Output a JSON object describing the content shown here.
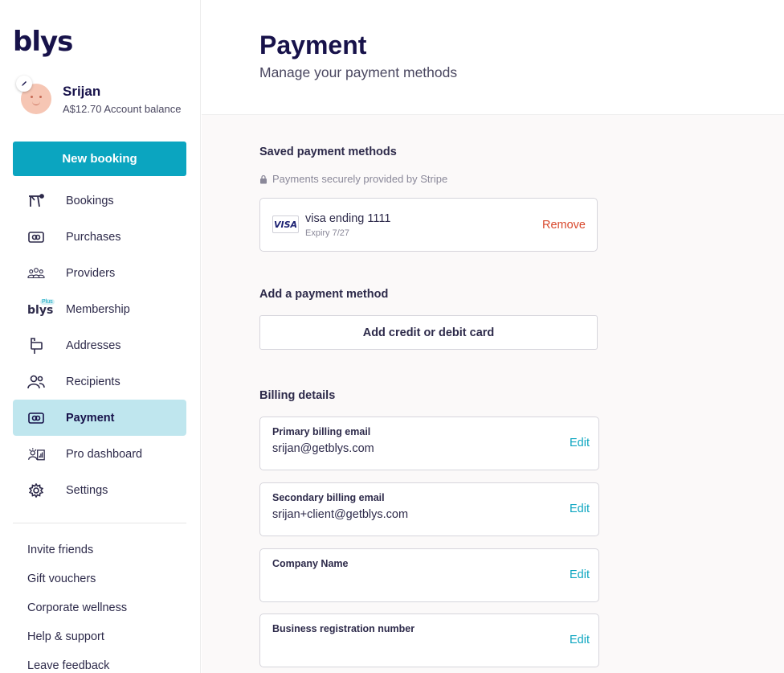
{
  "sidebar": {
    "logo": "blys",
    "user": {
      "name": "Srijan",
      "balance": "A$12.70 Account balance"
    },
    "new_booking_label": "New booking",
    "nav": [
      {
        "label": "Bookings",
        "icon": "massage-table-icon"
      },
      {
        "label": "Purchases",
        "icon": "money-icon"
      },
      {
        "label": "Providers",
        "icon": "providers-group-icon"
      },
      {
        "label": "Membership",
        "icon": "blys-plus-icon",
        "badge": "Plus",
        "icon_text": "blys"
      },
      {
        "label": "Addresses",
        "icon": "mailbox-icon"
      },
      {
        "label": "Recipients",
        "icon": "people-icon"
      },
      {
        "label": "Payment",
        "icon": "money-icon",
        "active": true
      },
      {
        "label": "Pro dashboard",
        "icon": "pro-dashboard-icon"
      },
      {
        "label": "Settings",
        "icon": "gear-icon"
      }
    ],
    "links": [
      "Invite friends",
      "Gift vouchers",
      "Corporate wellness",
      "Help & support",
      "Leave feedback"
    ]
  },
  "header": {
    "title": "Payment",
    "subtitle": "Manage your payment methods"
  },
  "saved_methods": {
    "title": "Saved payment methods",
    "stripe_note": "Payments securely provided by Stripe",
    "card": {
      "brand": "VISA",
      "number": "visa ending 1111",
      "expiry": "Expiry 7/27",
      "remove_label": "Remove"
    }
  },
  "add_method": {
    "title": "Add a payment method",
    "button_label": "Add credit or debit card"
  },
  "billing": {
    "title": "Billing details",
    "edit_label": "Edit",
    "fields": [
      {
        "label": "Primary billing email",
        "value": "srijan@getblys.com"
      },
      {
        "label": "Secondary billing email",
        "value": "srijan+client@getblys.com"
      },
      {
        "label": "Company Name",
        "value": ""
      },
      {
        "label": "Business registration number",
        "value": ""
      }
    ]
  },
  "colors": {
    "brand_navy": "#17124a",
    "accent_teal": "#0ba5c0",
    "active_nav_bg": "#bfe6ee",
    "danger": "#d8492d"
  }
}
